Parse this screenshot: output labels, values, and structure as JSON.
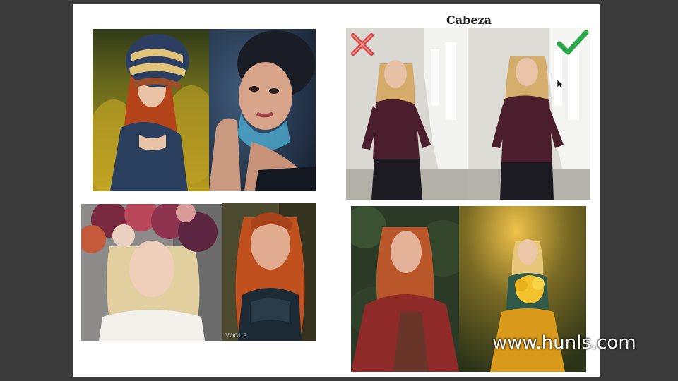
{
  "slide": {
    "title": "Cabeza",
    "watermark": "www.hunls.com",
    "magazine_logo": "VOGUE"
  },
  "markers": {
    "wrong": {
      "icon": "cross-icon",
      "color": "#e03a3a"
    },
    "right": {
      "icon": "checkmark-icon",
      "color": "#2aa84a"
    }
  },
  "photos": [
    {
      "id": "knit-hat-redhead",
      "subject": "woman with red hair in knitted hat in a yellow field"
    },
    {
      "id": "blue-paint-portrait",
      "subject": "dark-haired woman with blue paint on face"
    },
    {
      "id": "flower-crown-blonde",
      "subject": "blonde woman with flower crown"
    },
    {
      "id": "vogue-redhead",
      "subject": "red-haired woman in dark lace top"
    },
    {
      "id": "hallway-tilted",
      "subject": "woman in corridor with head tilted"
    },
    {
      "id": "hallway-straight",
      "subject": "woman in corridor with head upright"
    },
    {
      "id": "forest-redhead",
      "subject": "red-haired woman in red coat in forest"
    },
    {
      "id": "sunlit-bouquet",
      "subject": "blonde woman holding yellow flowers in sunlit forest"
    }
  ]
}
